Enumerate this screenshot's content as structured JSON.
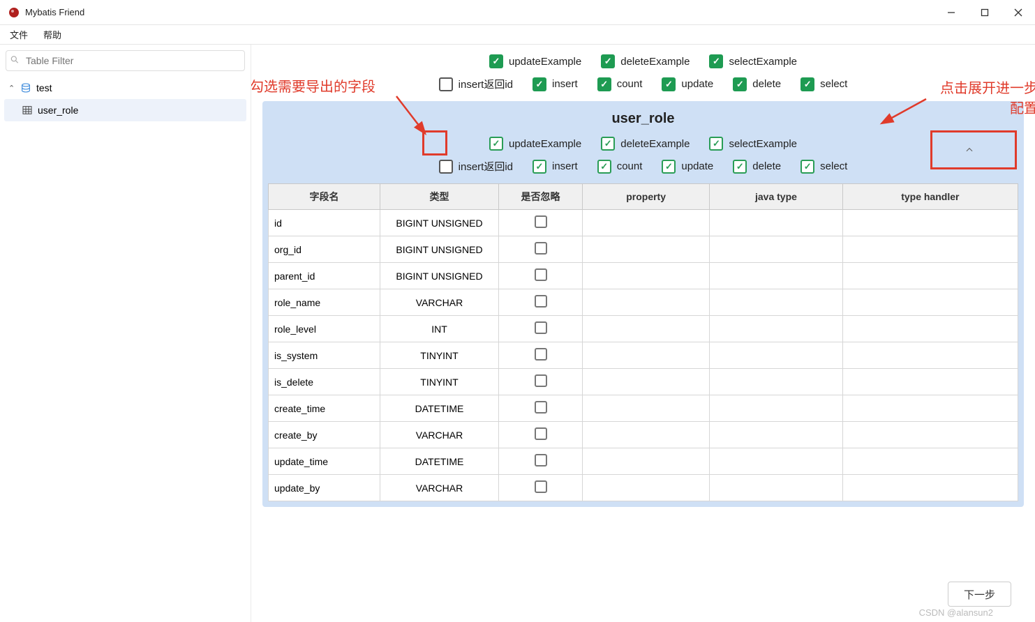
{
  "window": {
    "title": "Mybatis Friend"
  },
  "menu": {
    "file": "文件",
    "help": "帮助"
  },
  "sidebar": {
    "filter_placeholder": "Table Filter",
    "db_name": "test",
    "table_name": "user_role"
  },
  "checks_top": {
    "updateExample": "updateExample",
    "deleteExample": "deleteExample",
    "selectExample": "selectExample",
    "insertReturnId": "insert返回id",
    "insert": "insert",
    "count": "count",
    "update": "update",
    "delete": "delete",
    "select": "select"
  },
  "panel": {
    "title": "user_role",
    "updateExample": "updateExample",
    "deleteExample": "deleteExample",
    "selectExample": "selectExample",
    "insertReturnId": "insert返回id",
    "insert": "insert",
    "count": "count",
    "update": "update",
    "delete": "delete",
    "select": "select"
  },
  "table": {
    "headers": {
      "field": "字段名",
      "type": "类型",
      "ignore": "是否忽略",
      "property": "property",
      "javatype": "java type",
      "typehandler": "type handler"
    },
    "rows": [
      {
        "field": "id",
        "type": "BIGINT UNSIGNED"
      },
      {
        "field": "org_id",
        "type": "BIGINT UNSIGNED"
      },
      {
        "field": "parent_id",
        "type": "BIGINT UNSIGNED"
      },
      {
        "field": "role_name",
        "type": "VARCHAR"
      },
      {
        "field": "role_level",
        "type": "INT"
      },
      {
        "field": "is_system",
        "type": "TINYINT"
      },
      {
        "field": "is_delete",
        "type": "TINYINT"
      },
      {
        "field": "create_time",
        "type": "DATETIME"
      },
      {
        "field": "create_by",
        "type": "VARCHAR"
      },
      {
        "field": "update_time",
        "type": "DATETIME"
      },
      {
        "field": "update_by",
        "type": "VARCHAR"
      }
    ]
  },
  "annotations": {
    "left": "勾选需要导出的字段",
    "right1": "点击展开进一步",
    "right2": "配置"
  },
  "footer": {
    "next": "下一步",
    "watermark": "CSDN @alansun2"
  }
}
